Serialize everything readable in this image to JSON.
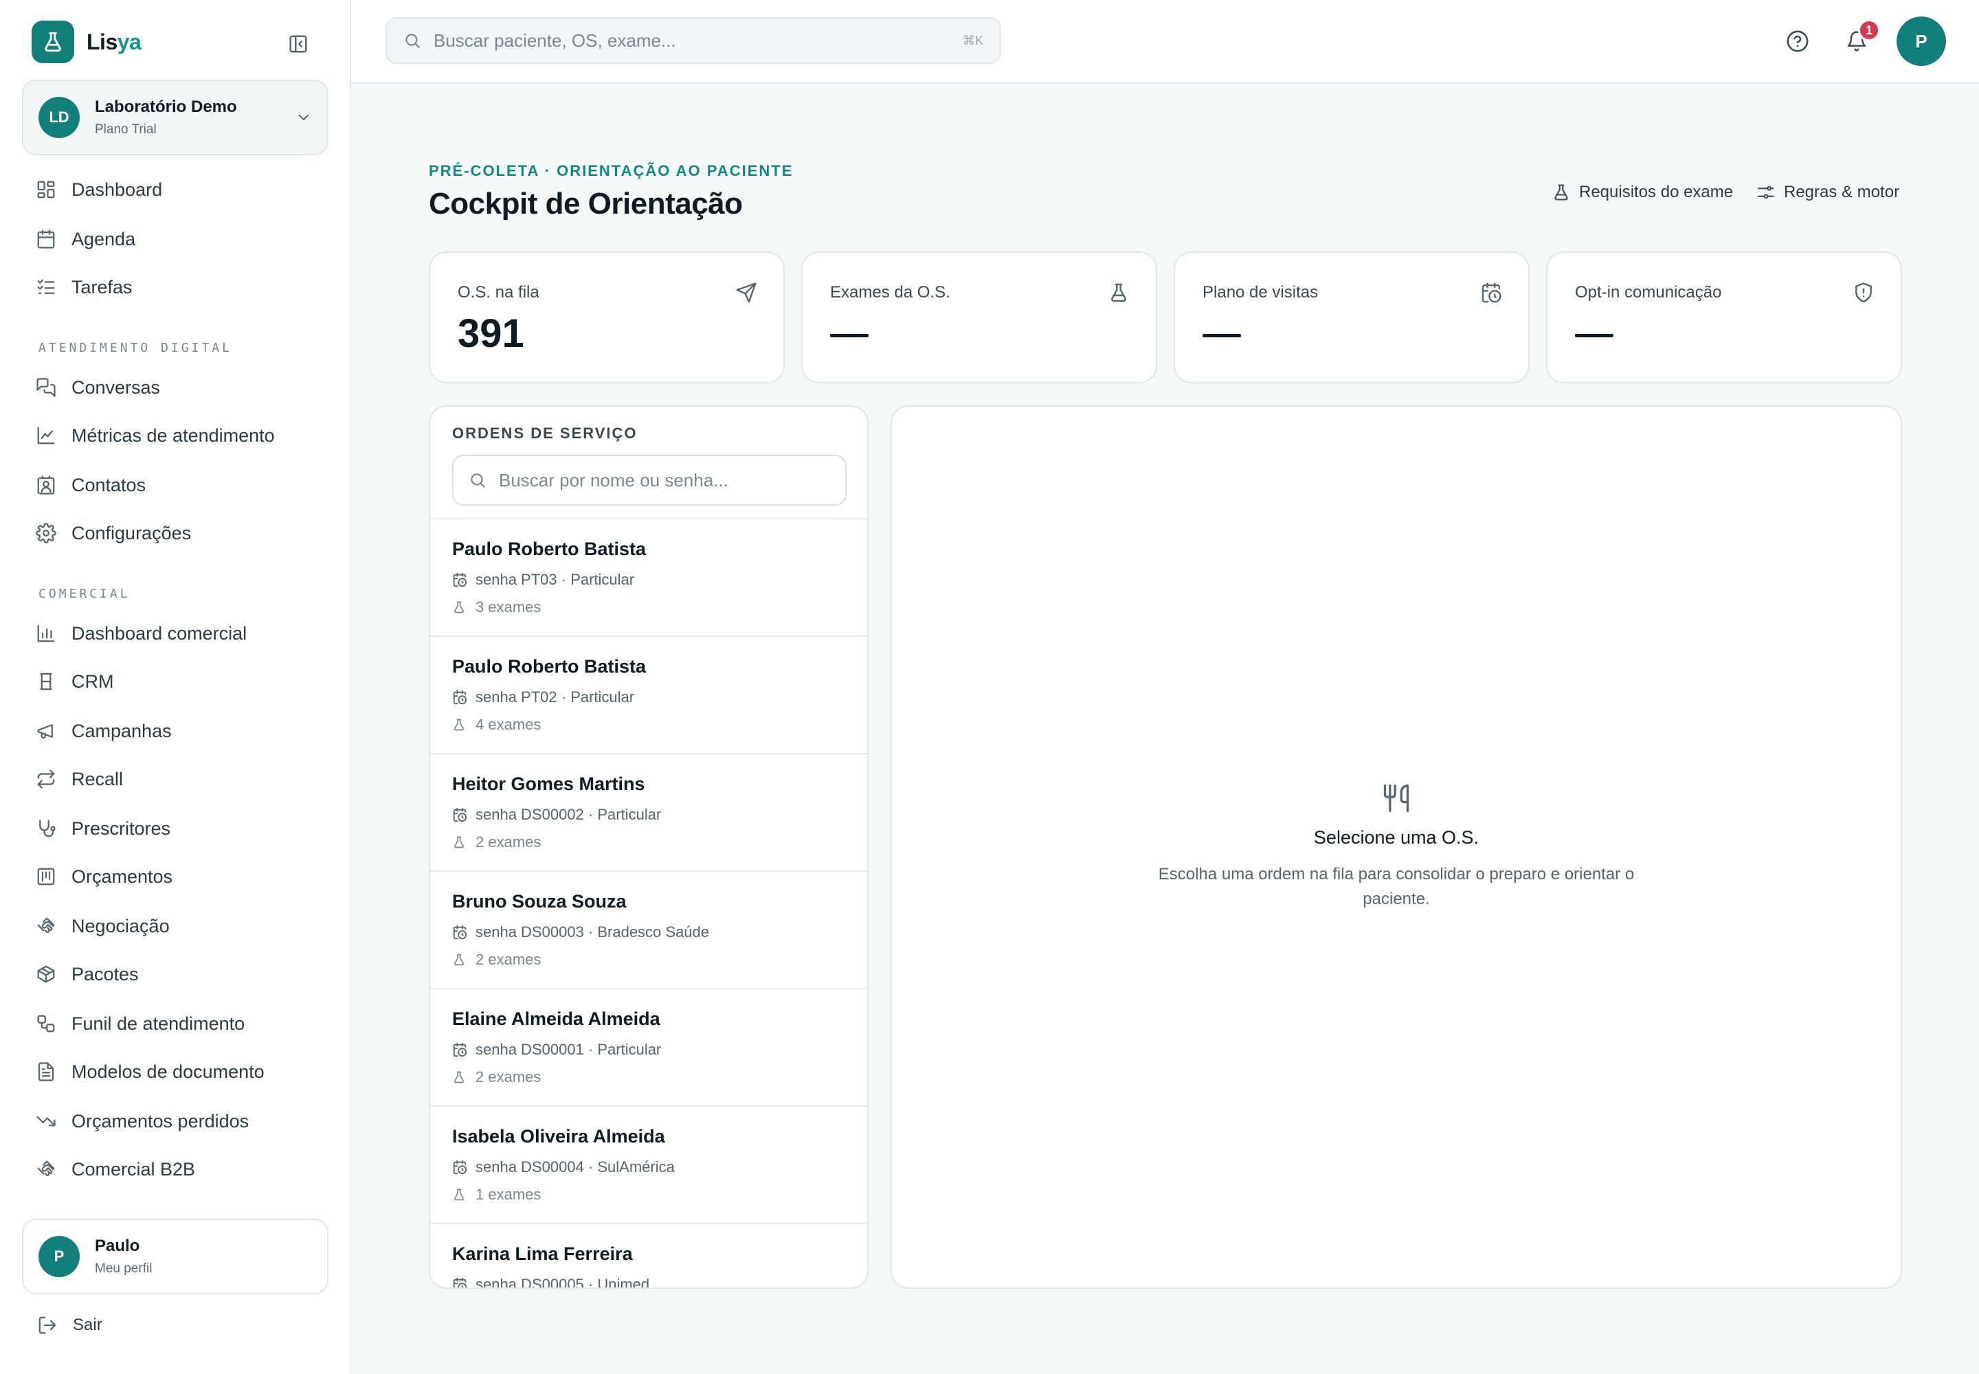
{
  "brand": {
    "name_main": "Lis",
    "name_accent": "ya"
  },
  "workspace": {
    "initials": "LD",
    "name": "Laboratório Demo",
    "plan": "Plano Trial"
  },
  "nav": {
    "main": [
      {
        "label": "Dashboard",
        "icon": "grid-icon"
      },
      {
        "label": "Agenda",
        "icon": "calendar-icon"
      },
      {
        "label": "Tarefas",
        "icon": "checklist-icon"
      }
    ],
    "section_digital": "ATENDIMENTO DIGITAL",
    "digital": [
      {
        "label": "Conversas",
        "icon": "chat-icon"
      },
      {
        "label": "Métricas de atendimento",
        "icon": "line-chart-icon"
      },
      {
        "label": "Contatos",
        "icon": "contact-icon"
      },
      {
        "label": "Configurações",
        "icon": "gear-icon"
      }
    ],
    "section_commercial": "COMERCIAL",
    "commercial": [
      {
        "label": "Dashboard comercial",
        "icon": "bar-chart-icon"
      },
      {
        "label": "CRM",
        "icon": "crm-icon"
      },
      {
        "label": "Campanhas",
        "icon": "megaphone-icon"
      },
      {
        "label": "Recall",
        "icon": "repeat-icon"
      },
      {
        "label": "Prescritores",
        "icon": "stethoscope-icon"
      },
      {
        "label": "Orçamentos",
        "icon": "receipt-icon"
      },
      {
        "label": "Negociação",
        "icon": "handshake-icon"
      },
      {
        "label": "Pacotes",
        "icon": "package-icon"
      },
      {
        "label": "Funil de atendimento",
        "icon": "workflow-icon"
      },
      {
        "label": "Modelos de documento",
        "icon": "document-icon"
      },
      {
        "label": "Orçamentos perdidos",
        "icon": "trending-down-icon"
      },
      {
        "label": "Comercial B2B",
        "icon": "handshake-icon"
      }
    ]
  },
  "profile": {
    "initial": "P",
    "name": "Paulo",
    "subtitle": "Meu perfil"
  },
  "logout": {
    "label": "Sair"
  },
  "topbar": {
    "search_placeholder": "Buscar paciente, OS, exame...",
    "shortcut": "⌘K",
    "notifications_count": "1",
    "avatar_initial": "P"
  },
  "page": {
    "eyebrow": "PRÉ-COLETA · ORIENTAÇÃO AO PACIENTE",
    "title": "Cockpit de Orientação",
    "action_requirements": "Requisitos do exame",
    "action_rules": "Regras & motor"
  },
  "stats": [
    {
      "label": "O.S. na fila",
      "value": "391",
      "icon": "send-icon"
    },
    {
      "label": "Exames da O.S.",
      "value": "—",
      "icon": "flask-icon"
    },
    {
      "label": "Plano de visitas",
      "value": "—",
      "icon": "calendar-clock-icon"
    },
    {
      "label": "Opt-in comunicação",
      "value": "—",
      "icon": "shield-alert-icon"
    }
  ],
  "orders": {
    "title": "ORDENS DE SERVIÇO",
    "search_placeholder": "Buscar por nome ou senha...",
    "items": [
      {
        "name": "Paulo Roberto Batista",
        "meta": "senha PT03 · Particular",
        "exams": "3 exames"
      },
      {
        "name": "Paulo Roberto Batista",
        "meta": "senha PT02 · Particular",
        "exams": "4 exames"
      },
      {
        "name": "Heitor Gomes Martins",
        "meta": "senha DS00002 · Particular",
        "exams": "2 exames"
      },
      {
        "name": "Bruno Souza Souza",
        "meta": "senha DS00003 · Bradesco Saúde",
        "exams": "2 exames"
      },
      {
        "name": "Elaine Almeida Almeida",
        "meta": "senha DS00001 · Particular",
        "exams": "2 exames"
      },
      {
        "name": "Isabela Oliveira Almeida",
        "meta": "senha DS00004 · SulAmérica",
        "exams": "1 exames"
      },
      {
        "name": "Karina Lima Ferreira",
        "meta": "senha DS00005 · Unimed",
        "exams": ""
      }
    ]
  },
  "empty_state": {
    "icon": "utensils-icon",
    "title": "Selecione uma O.S.",
    "description": "Escolha uma ordem na fila para consolidar o preparo e orientar o paciente."
  },
  "colors": {
    "accent": "#127f7a",
    "badge": "#d6394d",
    "background": "#f5f8f9"
  }
}
